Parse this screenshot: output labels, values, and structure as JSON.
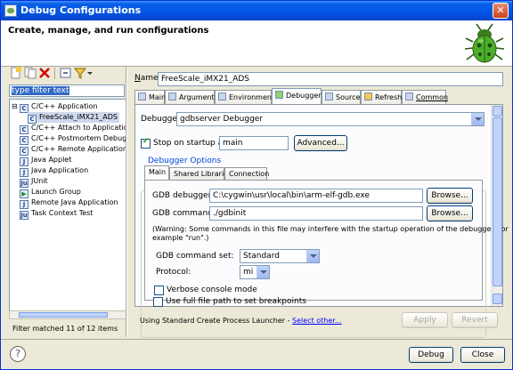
{
  "window": {
    "title": "Debug Configurations",
    "close_glyph": "✕"
  },
  "header": {
    "title": "Create, manage, and run configurations"
  },
  "toolbar": {
    "icons": [
      "new-launch-config-icon",
      "duplicate-icon",
      "delete-icon",
      "collapse-all-icon",
      "filter-icon",
      "dropdown-icon"
    ]
  },
  "filter": {
    "value": "type filter text"
  },
  "tree": {
    "items": [
      {
        "label": "C/C++ Application",
        "icon": "C",
        "twisty": "⊟",
        "level": 0
      },
      {
        "label": "FreeScale_iMX21_ADS",
        "icon": "C",
        "twisty": "",
        "level": 1,
        "selected": true
      },
      {
        "label": "C/C++ Attach to Applicatio",
        "icon": "C",
        "twisty": "",
        "level": 0
      },
      {
        "label": "C/C++ Postmortem Debugg",
        "icon": "C",
        "twisty": "",
        "level": 0
      },
      {
        "label": "C/C++ Remote Application",
        "icon": "C",
        "twisty": "",
        "level": 0
      },
      {
        "label": "Java Applet",
        "icon": "J",
        "twisty": "",
        "level": 0
      },
      {
        "label": "Java Application",
        "icon": "J",
        "twisty": "",
        "level": 0
      },
      {
        "label": "JUnit",
        "icon": "Ju",
        "twisty": "",
        "level": 0
      },
      {
        "label": "Launch Group",
        "icon": "▶",
        "twisty": "",
        "level": 0
      },
      {
        "label": "Remote Java Application",
        "icon": "J",
        "twisty": "",
        "level": 0
      },
      {
        "label": "Task Context Test",
        "icon": "Ju",
        "twisty": "",
        "level": 0
      }
    ],
    "status": "Filter matched 11 of 12 items"
  },
  "config": {
    "name_label_u": "N",
    "name_label_rest": "ame:",
    "name_value": "FreeScale_iMX21_ADS"
  },
  "tabs": [
    {
      "label": "Main",
      "icon": "main-tab-icon"
    },
    {
      "label": "Arguments",
      "icon": "arguments-tab-icon"
    },
    {
      "label": "Environment",
      "icon": "environment-tab-icon"
    },
    {
      "label": "Debugger",
      "icon": "debugger-tab-icon",
      "active": true
    },
    {
      "label": "Source",
      "icon": "source-tab-icon"
    },
    {
      "label": "Refresh",
      "icon": "refresh-tab-icon"
    },
    {
      "label": "Common",
      "icon": "common-tab-icon"
    }
  ],
  "debugger_tab": {
    "debugger_label": "Debugger:",
    "debugger_value": "gdbserver Debugger",
    "stop_on_startup_label": "Stop on startup at:",
    "stop_on_startup_checked": true,
    "stop_on_startup_value": "main",
    "advanced_button": "Advanced...",
    "options_group": "Debugger Options",
    "inner_tabs": [
      "Main",
      "Shared Libraries",
      "Connection"
    ],
    "gdb_debugger_label": "GDB debugger:",
    "gdb_debugger_value": "C:\\cygwin\\usr\\local\\bin\\arm-elf-gdb.exe",
    "browse_1": "Browse...",
    "gdb_command_file_label": "GDB command file:",
    "gdb_command_file_value": "./gdbinit",
    "browse_2": "Browse...",
    "warning_line1": "(Warning: Some commands in this file may interfere with the startup operation of the debugger, for",
    "warning_line2": "example \"run\".)",
    "command_set_label": "GDB command set:",
    "command_set_value": "Standard",
    "protocol_label": "Protocol:",
    "protocol_value": "mi",
    "verbose_label": "Verbose console mode",
    "verbose_checked": false,
    "fullpath_label": "Use full file path to set breakpoints",
    "fullpath_checked": false
  },
  "launcher": {
    "text": "Using Standard Create Process Launcher - ",
    "link": "Select other..."
  },
  "buttons": {
    "apply": "Apply",
    "revert": "Revert",
    "debug": "Debug",
    "close": "Close"
  },
  "help": {
    "glyph": "?"
  },
  "colors": {
    "titlebar": "#0054e3",
    "accent": "#316ac5",
    "link": "#0000ff",
    "bug": "#4caf2a"
  }
}
